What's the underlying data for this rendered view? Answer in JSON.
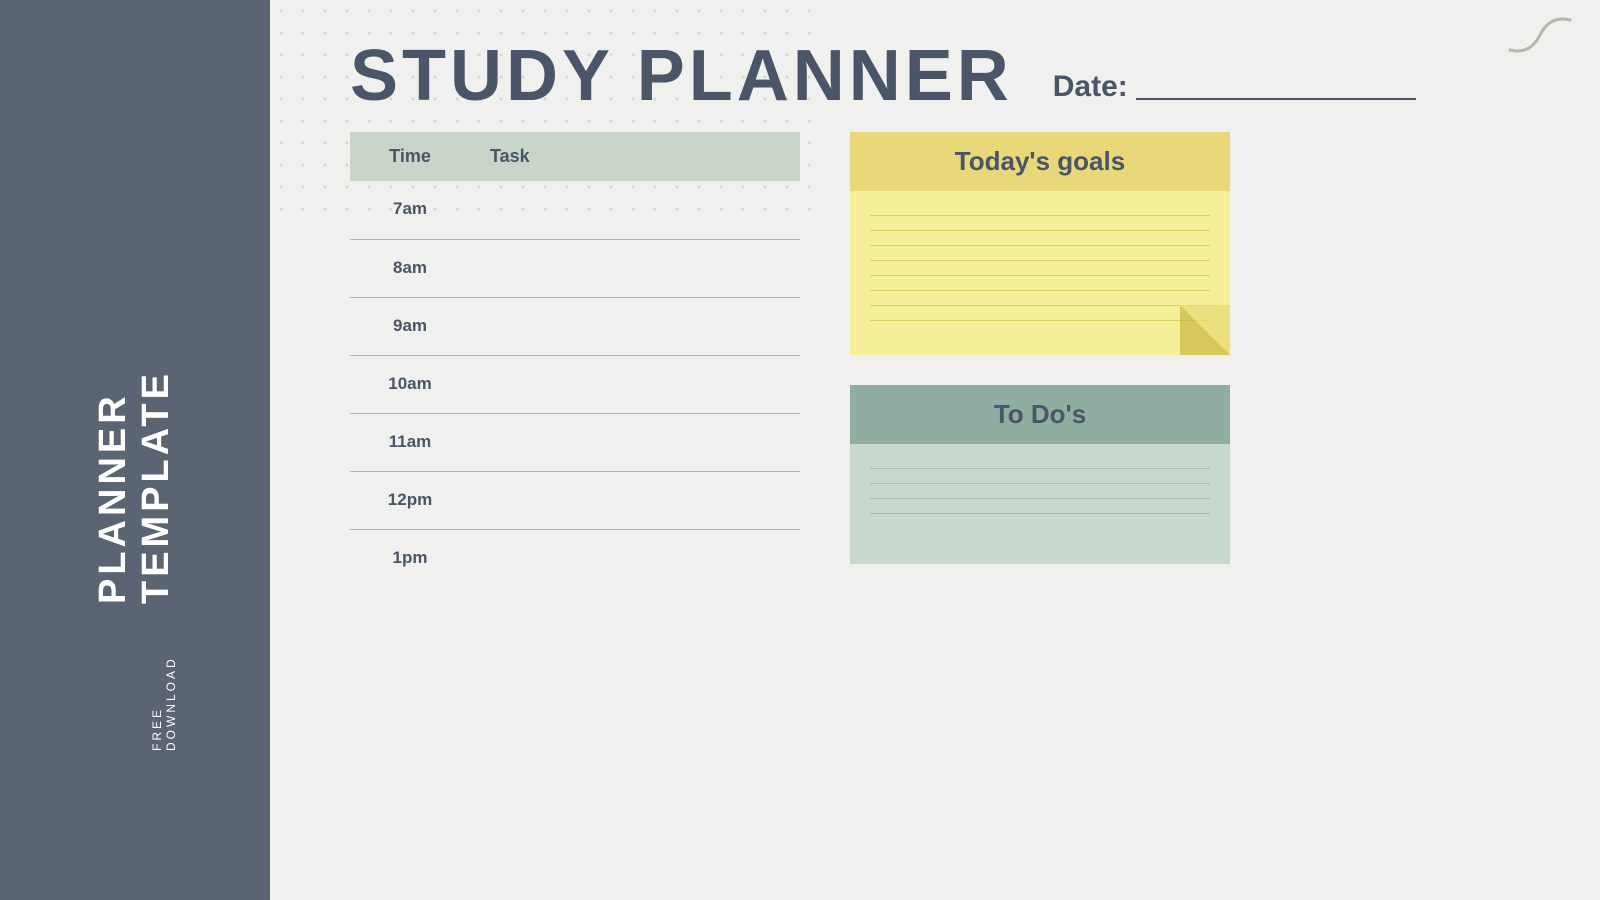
{
  "sidebar": {
    "free_download": "FREE DOWNLOAD",
    "planner_template": "PLANNER TEMPLATE"
  },
  "header": {
    "title": "STUDY PLANNER",
    "date_label": "Date:"
  },
  "schedule": {
    "col_time": "Time",
    "col_task": "Task",
    "rows": [
      {
        "time": "7am",
        "task": ""
      },
      {
        "time": "8am",
        "task": ""
      },
      {
        "time": "9am",
        "task": ""
      },
      {
        "time": "10am",
        "task": ""
      },
      {
        "time": "11am",
        "task": ""
      },
      {
        "time": "12pm",
        "task": ""
      },
      {
        "time": "1pm",
        "task": ""
      }
    ]
  },
  "goals": {
    "title": "Today's goals",
    "lines": 8
  },
  "todos": {
    "title": "To Do's",
    "lines": 4
  }
}
